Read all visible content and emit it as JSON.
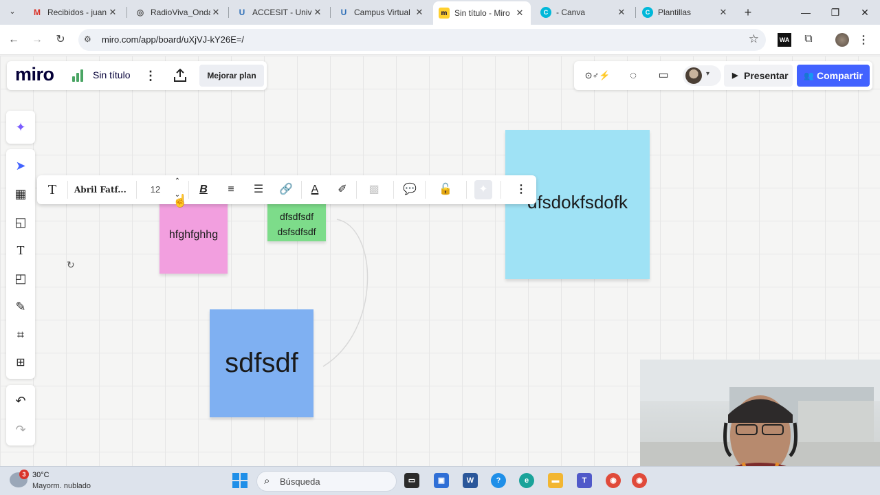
{
  "browser": {
    "tabs": [
      {
        "title": "Recibidos - juan",
        "icon": "gmail-icon"
      },
      {
        "title": "RadioViva_Onda",
        "icon": "globe-icon"
      },
      {
        "title": "ACCESIT - Unive",
        "icon": "u-logo-icon"
      },
      {
        "title": "Campus Virtual",
        "icon": "u-logo-icon"
      },
      {
        "title": "Sin título - Miro",
        "icon": "miro-icon",
        "active": true
      },
      {
        "title": "- Canva",
        "icon": "canva-icon"
      },
      {
        "title": "Plantillas",
        "icon": "canva-icon"
      }
    ],
    "url": "miro.com/app/board/uXjVJ-kY26E=/"
  },
  "miro": {
    "logo": "miro",
    "board_title": "Sin título",
    "upgrade_label": "Mejorar plan",
    "present_label": "Presentar",
    "share_label": "Compartir",
    "accent_color": "#4262ff"
  },
  "text_toolbar": {
    "font_name": "Abril Fatf...",
    "font_size": "12"
  },
  "stickies": [
    {
      "text": "hfghfghhg",
      "color": "#f29fdf"
    },
    {
      "text": "dfsdfsdf\ndsfsdfsdf",
      "color": "#7ddc8a"
    },
    {
      "text": "dfsdokfsdofk",
      "color": "#9fe2f5"
    },
    {
      "text": "sdfsdf",
      "color": "#7fb0f2"
    }
  ],
  "taskbar": {
    "weather_temp": "30°C",
    "weather_desc": "Mayorm. nublado",
    "notification_count": "3",
    "search_placeholder": "Búsqueda"
  }
}
